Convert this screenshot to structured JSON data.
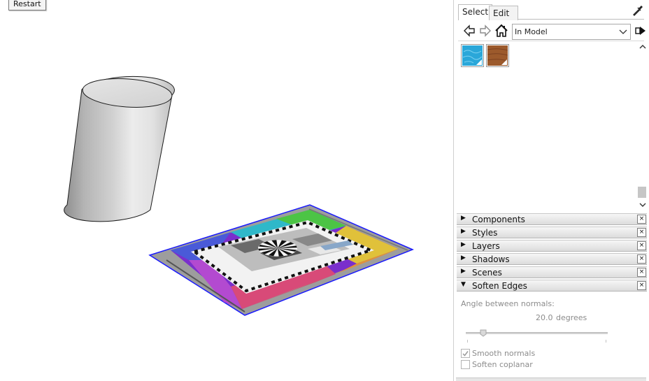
{
  "viewport": {
    "restart_label": "Restart"
  },
  "materials": {
    "tabs": [
      {
        "label": "Select",
        "active": true
      },
      {
        "label": "Edit",
        "active": false
      }
    ],
    "collection_value": "In Model",
    "swatches": [
      {
        "name": "water",
        "color": "#2aa7d9"
      },
      {
        "name": "wood",
        "color": "#9c5a2c"
      }
    ]
  },
  "panels": [
    {
      "title": "Components",
      "expanded": false
    },
    {
      "title": "Styles",
      "expanded": false
    },
    {
      "title": "Layers",
      "expanded": false
    },
    {
      "title": "Shadows",
      "expanded": false
    },
    {
      "title": "Scenes",
      "expanded": false
    },
    {
      "title": "Soften Edges",
      "expanded": true
    }
  ],
  "icons": {
    "collapsed": "▶",
    "expanded": "▼",
    "close": "×"
  },
  "soften": {
    "angle_label": "Angle between normals:",
    "angle_value": "20.0",
    "angle_unit": "degrees",
    "slider_fraction": 0.11,
    "smooth_normals_label": "Smooth normals",
    "smooth_normals_checked": true,
    "soften_coplanar_label": "Soften coplanar",
    "soften_coplanar_checked": false
  },
  "colors": {
    "selection_edge": "#1a1aff",
    "panel_header": "#e4e4e4",
    "disabled_text": "#8c8c8c"
  }
}
